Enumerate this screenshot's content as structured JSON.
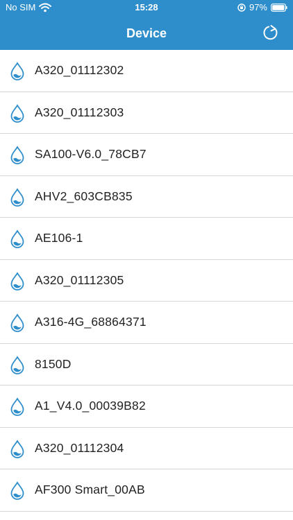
{
  "status_bar": {
    "carrier": "No SIM",
    "time": "15:28",
    "battery": "97%",
    "icons": [
      "wifi-icon",
      "rotation-lock-icon",
      "battery-icon"
    ]
  },
  "nav": {
    "title": "Device",
    "refresh_icon": "refresh-icon"
  },
  "theme": {
    "header_color": "#2e8ecb",
    "icon_color": "#2e8ecb",
    "divider_color": "#d6d6d6",
    "text_color": "#222222"
  },
  "devices": [
    {
      "name": "A320_01112302",
      "icon": "water-drop-icon"
    },
    {
      "name": "A320_01112303",
      "icon": "water-drop-icon"
    },
    {
      "name": "SA100-V6.0_78CB7",
      "icon": "water-drop-icon"
    },
    {
      "name": "AHV2_603CB835",
      "icon": "water-drop-icon"
    },
    {
      "name": "AE106-1",
      "icon": "water-drop-icon"
    },
    {
      "name": "A320_01112305",
      "icon": "water-drop-icon"
    },
    {
      "name": "A316-4G_68864371",
      "icon": "water-drop-icon"
    },
    {
      "name": "8150D",
      "icon": "water-drop-icon"
    },
    {
      "name": "A1_V4.0_00039B82",
      "icon": "water-drop-icon"
    },
    {
      "name": "A320_01112304",
      "icon": "water-drop-icon"
    },
    {
      "name": "AF300 Smart_00AB",
      "icon": "water-drop-icon"
    }
  ]
}
